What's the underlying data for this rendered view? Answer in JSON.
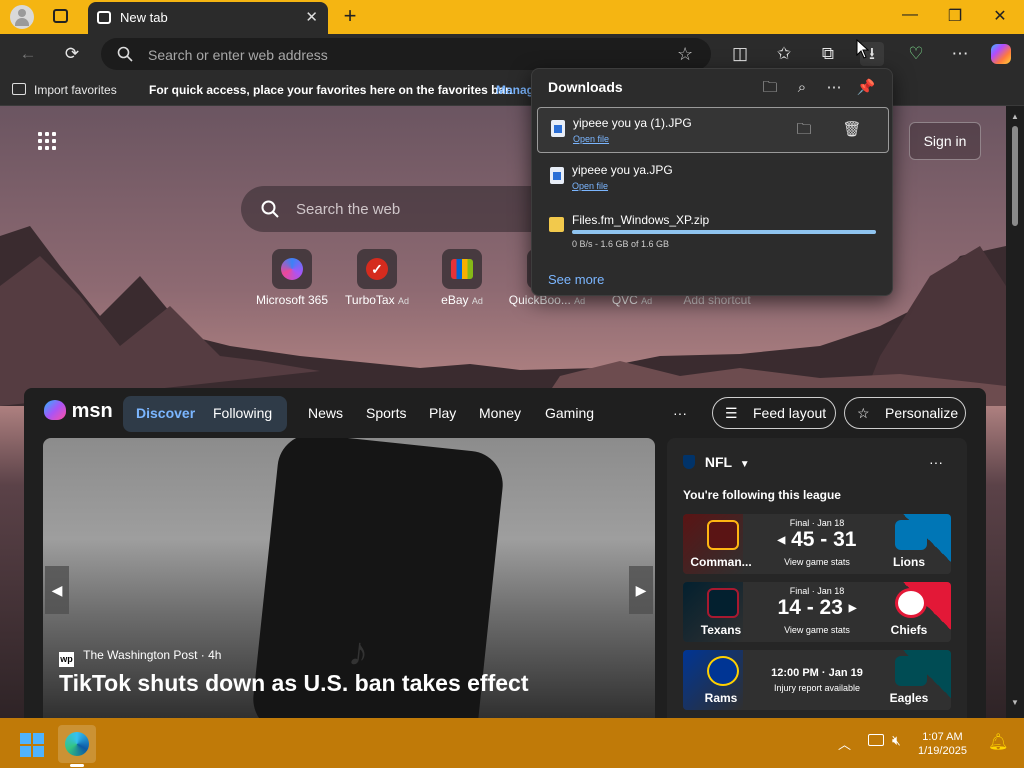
{
  "browser": {
    "tab_title": "New tab",
    "new_tab_icon": "plus-icon",
    "address_placeholder": "Search or enter web address",
    "favorites_bar": {
      "import_label": "Import favorites",
      "hint": "For quick access, place your favorites here on the favorites bar.",
      "manage_link": "Manag"
    }
  },
  "page": {
    "sign_in": "Sign in",
    "search_placeholder": "Search the web",
    "quick_links": [
      {
        "label": "Microsoft 365",
        "ad": ""
      },
      {
        "label": "TurboTax",
        "ad": "Ad"
      },
      {
        "label": "eBay",
        "ad": "Ad"
      },
      {
        "label": "QuickBoo...",
        "ad": "Ad"
      },
      {
        "label": "QVC",
        "ad": "Ad"
      },
      {
        "label": "Add shortcut",
        "ad": ""
      }
    ]
  },
  "feed": {
    "logo": "msn",
    "tabs": [
      "Discover",
      "Following"
    ],
    "nav": [
      "News",
      "Sports",
      "Play",
      "Money",
      "Gaming"
    ],
    "more": "···",
    "feed_layout": "Feed layout",
    "personalize": "Personalize",
    "hero": {
      "source": "The Washington Post",
      "age": "· 4h",
      "title": "TikTok shuts down as U.S. ban takes effect"
    },
    "nfl": {
      "league": "NFL",
      "subtitle": "You're following this league",
      "more": "···",
      "games": [
        {
          "status": "Final · Jan 18",
          "score": "45 - 31",
          "note": "View game stats",
          "home": "Comman...",
          "away": "Lions",
          "home_color": "#5a1414",
          "away_color": "#0076b6"
        },
        {
          "status": "Final · Jan 18",
          "score": "14 - 23",
          "note": "View game stats",
          "home": "Texans",
          "away": "Chiefs",
          "home_color": "#03202f",
          "away_color": "#e31837"
        },
        {
          "status": "12:00 PM · Jan 19",
          "score": "",
          "note": "Injury report available",
          "home": "Rams",
          "away": "Eagles",
          "home_color": "#003594",
          "away_color": "#004c54"
        }
      ]
    }
  },
  "downloads": {
    "title": "Downloads",
    "items": [
      {
        "name": "yipeee you ya (1).JPG",
        "sub": "Open file"
      },
      {
        "name": "yipeee you ya.JPG",
        "sub": "Open file"
      },
      {
        "name": "Files.fm_Windows_XP.zip",
        "sub": "0 B/s - 1.6 GB of 1.6 GB",
        "progress": 1.0
      }
    ],
    "see_more": "See more"
  },
  "taskbar": {
    "time": "1:07 AM",
    "date": "1/19/2025"
  },
  "colors": {
    "titlebar": "#f5b512",
    "taskbar": "#c07a08",
    "accent_link": "#7bb6ff",
    "progress": "#8fc4f0"
  }
}
